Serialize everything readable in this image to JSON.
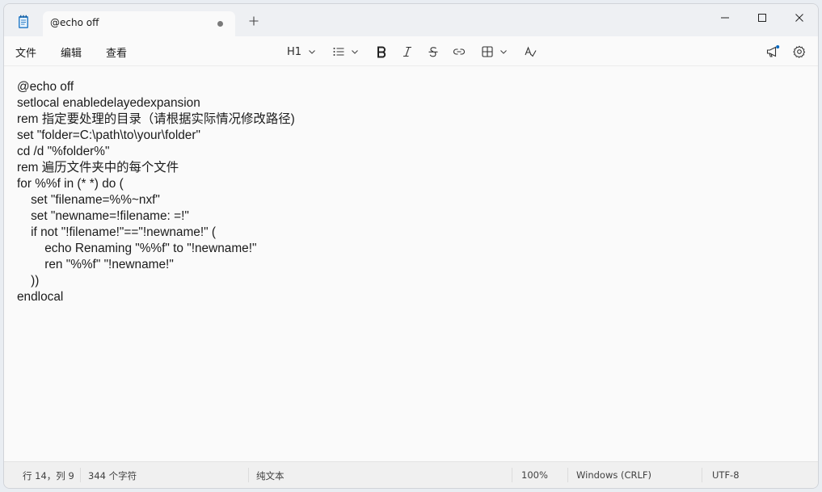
{
  "tab": {
    "title": "@echo off"
  },
  "menu": {
    "file": "文件",
    "edit": "编辑",
    "view": "查看"
  },
  "toolbar": {
    "heading": "H1"
  },
  "editor": {
    "lines": [
      "@echo off",
      "setlocal enabledelayedexpansion",
      "rem 指定要处理的目录（请根据实际情况修改路径)",
      "set \"folder=C:\\path\\to\\your\\folder\"",
      "cd /d \"%folder%\"",
      "rem 遍历文件夹中的每个文件",
      "for %%f in (* *) do (",
      "    set \"filename=%%~nxf\"",
      "    set \"newname=!filename: =!\"",
      "    if not \"!filename!\"==\"!newname!\" (",
      "        echo Renaming \"%%f\" to \"!newname!\"",
      "        ren \"%%f\" \"!newname!\"",
      "    ))",
      "endlocal"
    ]
  },
  "status": {
    "position": "行 14，列 9",
    "chars": "344 个字符",
    "format": "纯文本",
    "zoom": "100%",
    "line_ending": "Windows (CRLF)",
    "encoding": "UTF-8"
  },
  "colors": {
    "accent": "#0067c0",
    "notify_dot": "#0067c0"
  }
}
